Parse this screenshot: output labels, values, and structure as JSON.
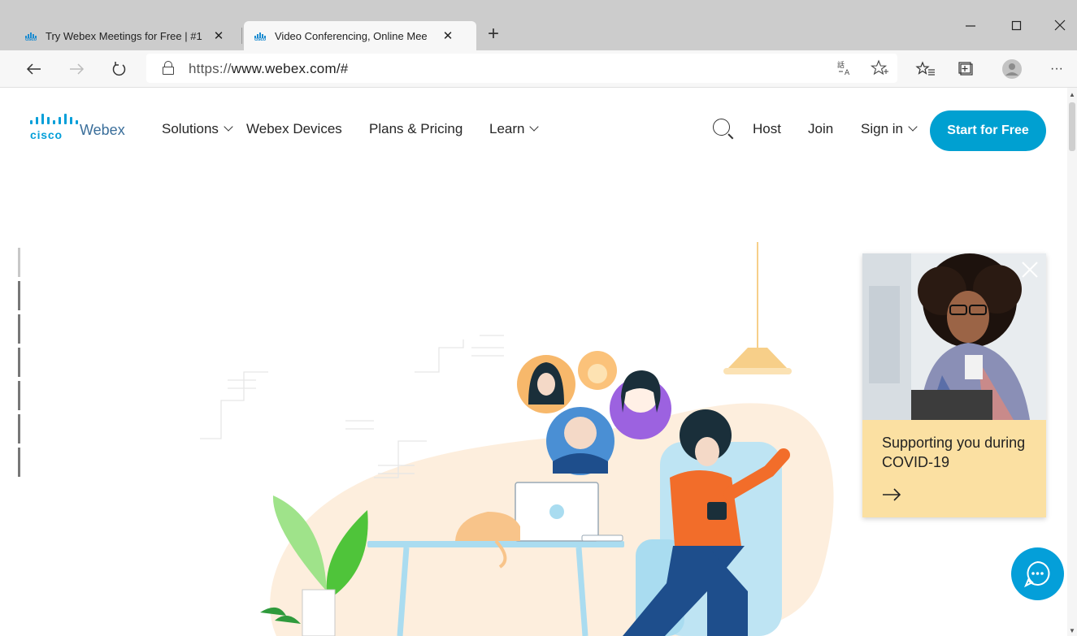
{
  "browser": {
    "tabs": [
      {
        "title": "Try Webex Meetings for Free | #1",
        "favicon": "cisco-favicon",
        "active": false
      },
      {
        "title": "Video Conferencing, Online Mee",
        "favicon": "cisco-favicon",
        "active": true
      }
    ],
    "favicon_text": "cisco",
    "new_tab_glyph": "+",
    "window_controls": {
      "minimize": "—",
      "maximize": "☐",
      "close": "✕"
    },
    "url_scheme": "https://",
    "url_rest": "www.webex.com/#",
    "more_glyph": "···"
  },
  "site": {
    "logo_cisco": "cisco",
    "logo_webex": "Webex",
    "nav": {
      "solutions": "Solutions",
      "devices": "Webex Devices",
      "plans": "Plans & Pricing",
      "learn": "Learn"
    },
    "host": "Host",
    "join": "Join",
    "signin": "Sign in",
    "cta": "Start for Free"
  },
  "covid_card": {
    "text": "Supporting you during COVID-19"
  },
  "colors": {
    "brand_blue": "#049fd9",
    "cta_blue": "#00a0d1",
    "card_bg": "#fbe0a2",
    "tabstrip": "#cccccc",
    "toolbar": "#f7f7f7"
  },
  "icons": [
    "back-arrow-icon",
    "forward-arrow-icon",
    "refresh-icon",
    "lock-icon",
    "translate-icon",
    "favorite-star-icon",
    "favorites-icon",
    "collections-icon",
    "profile-icon",
    "search-icon",
    "chevron-down-icon",
    "arrow-right-icon",
    "close-icon",
    "chat-icon"
  ]
}
